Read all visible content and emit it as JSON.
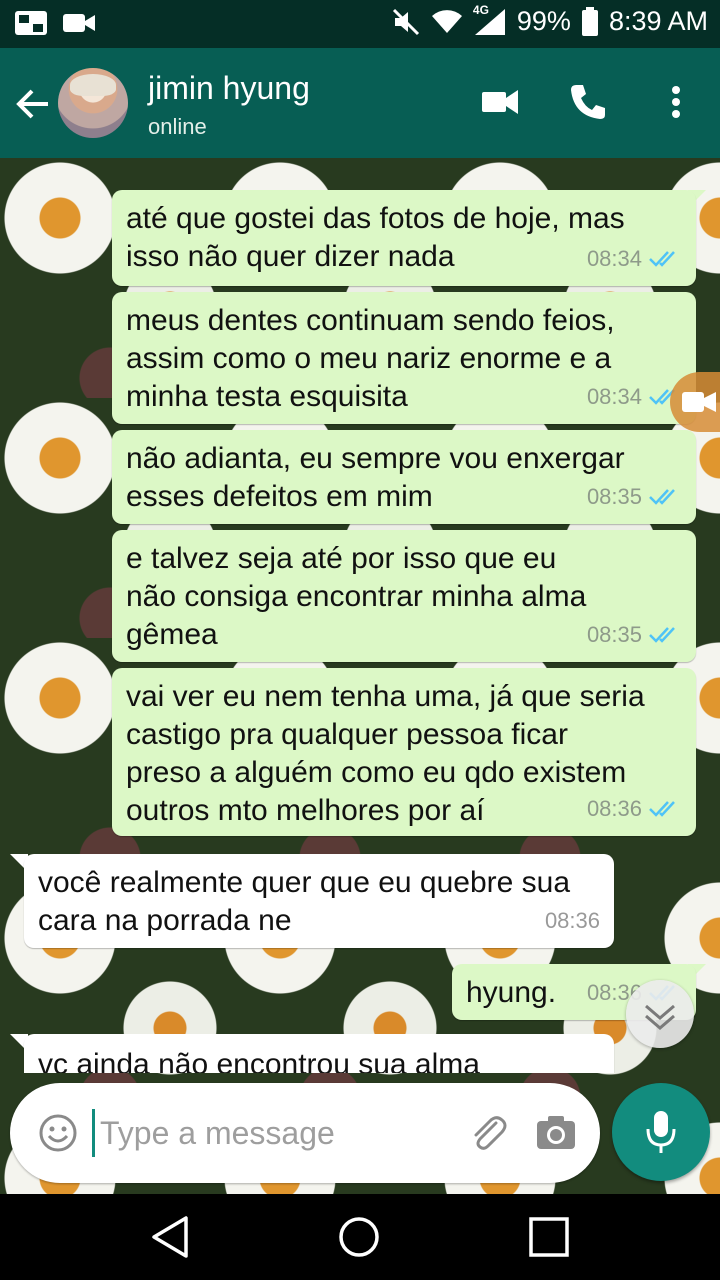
{
  "status_bar": {
    "network_label": "4G",
    "battery": "99%",
    "time": "8:39 AM"
  },
  "header": {
    "contact_name": "jimin hyung",
    "contact_status": "online"
  },
  "messages": [
    {
      "direction": "out",
      "lines": [
        "até que gostei das fotos de hoje, mas",
        "isso não quer dizer nada"
      ],
      "time": "08:34",
      "status": "read"
    },
    {
      "direction": "out",
      "lines": [
        "meus dentes continuam sendo feios,",
        "assim como o meu nariz enorme e a",
        "minha testa esquisita"
      ],
      "time": "08:34",
      "status": "read"
    },
    {
      "direction": "out",
      "lines": [
        "não adianta, eu sempre vou enxergar",
        "esses defeitos em mim"
      ],
      "time": "08:35",
      "status": "read"
    },
    {
      "direction": "out",
      "lines": [
        "e talvez seja até por isso que eu",
        "não consiga encontrar minha alma",
        "gêmea"
      ],
      "time": "08:35",
      "status": "read"
    },
    {
      "direction": "out",
      "lines": [
        "vai ver eu nem tenha uma, já que seria",
        "castigo pra qualquer pessoa ficar",
        "preso a alguém como eu qdo existem",
        "outros mto melhores por aí"
      ],
      "time": "08:36",
      "status": "read"
    },
    {
      "direction": "in",
      "lines": [
        "você realmente quer que eu quebre sua",
        "cara na porrada ne"
      ],
      "time": "08:36"
    },
    {
      "direction": "out",
      "lines": [
        "hyung."
      ],
      "time": "08:36",
      "status": "read"
    },
    {
      "direction": "in",
      "lines": [
        "vc ainda não encontrou sua alma"
      ],
      "time": ""
    }
  ],
  "input": {
    "placeholder": "Type a message",
    "value": ""
  },
  "colors": {
    "header": "#075e54",
    "status_bar": "#052e26",
    "outgoing_bubble": "#dcf8c6",
    "incoming_bubble": "#ffffff",
    "read_tick": "#4fc3f7",
    "mic_button": "#128c7e"
  },
  "icons": {
    "back": "arrow-left-icon",
    "video_call": "video-camera-icon",
    "voice_call": "phone-icon",
    "menu": "more-vertical-icon",
    "emoji": "smiley-icon",
    "attach": "paperclip-icon",
    "camera": "camera-icon",
    "mic": "microphone-icon",
    "scroll_down": "chevron-double-down-icon"
  }
}
